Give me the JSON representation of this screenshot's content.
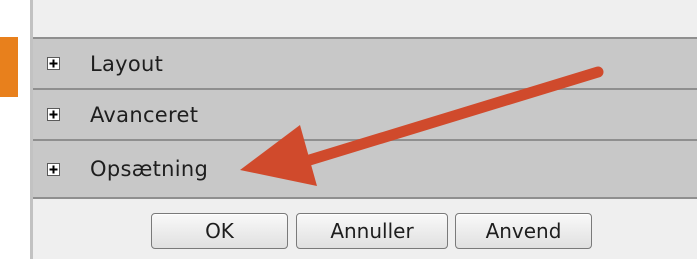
{
  "panels": [
    {
      "label": "Layout",
      "icon": "plus-icon"
    },
    {
      "label": "Avanceret",
      "icon": "plus-icon"
    },
    {
      "label": "Opsætning",
      "icon": "plus-icon"
    }
  ],
  "buttons": {
    "ok": "OK",
    "cancel": "Annuller",
    "apply": "Anvend"
  },
  "colors": {
    "accent": "#e8801c",
    "annotation_arrow": "#d04a2c",
    "panel_background": "#c8c8c8"
  }
}
